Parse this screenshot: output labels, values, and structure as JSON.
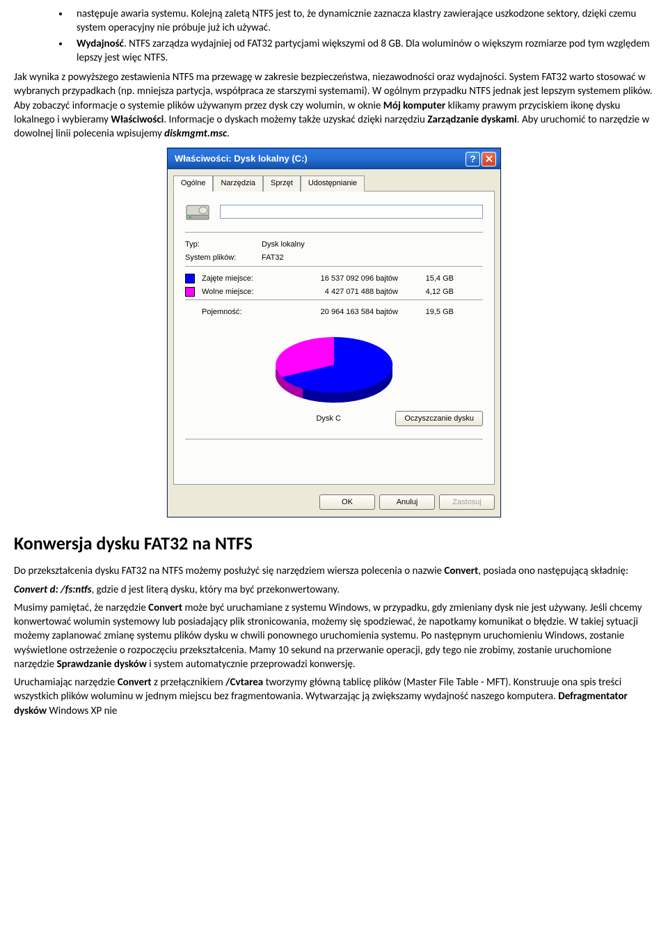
{
  "bullets": {
    "b1_pre": "następuje awaria systemu. Kolejną zaletą NTFS jest to, że dynamicznie zaznacza klastry zawierające uszkodzone sektory, dzięki czemu system operacyjny nie próbuje już ich używać.",
    "b2_head": "Wydajność",
    "b2_rest": ". NTFS zarządza wydajniej od FAT32 partycjami większymi od 8 GB. Dla woluminów o większym rozmiarze pod tym względem lepszy jest więc NTFS."
  },
  "para1": {
    "s1": "Jak wynika z powyższego zestawienia NTFS ma przewagę w zakresie bezpieczeństwa, niezawodności oraz wydajności. System FAT32 warto stosować w wybranych przypadkach (np. mniejsza partycja, współpraca ze starszymi systemami). W ogólnym przypadku NTFS jednak jest lepszym systemem plików. Aby zobaczyć informacje o systemie plików używanym przez dysk czy wolumin, w oknie ",
    "s1_b1": "Mój komputer",
    "s2": " klikamy prawym przyciskiem ikonę dysku lokalnego i wybieramy ",
    "s2_b1": "Właściwości",
    "s3": ". Informacje o dyskach możemy także uzyskać dzięki narzędziu ",
    "s3_b1": "Zarządzanie dyskami",
    "s4": ". Aby uruchomić to narzędzie w dowolnej linii polecenia wpisujemy ",
    "s4_bi": "diskmgmt.msc",
    "s5": "."
  },
  "dialog": {
    "title": "Właściwości: Dysk lokalny (C:)",
    "tabs": [
      "Ogólne",
      "Narzędzia",
      "Sprzęt",
      "Udostępnianie"
    ],
    "type_label": "Typ:",
    "type_value": "Dysk lokalny",
    "fs_label": "System plików:",
    "fs_value": "FAT32",
    "used_label": "Zajęte miejsce:",
    "used_bytes": "16 537 092 096 bajtów",
    "used_gb": "15,4 GB",
    "free_label": "Wolne miejsce:",
    "free_bytes": "4 427 071 488 bajtów",
    "free_gb": "4,12 GB",
    "cap_label": "Pojemność:",
    "cap_bytes": "20 964 163 584 bajtów",
    "cap_gb": "19,5 GB",
    "pie_label": "Dysk C",
    "cleanup": "Oczyszczanie dysku",
    "ok": "OK",
    "cancel": "Anuluj",
    "apply": "Zastosuj"
  },
  "heading2": "Konwersja dysku FAT32 na NTFS",
  "para2": {
    "s1": "Do przekształcenia dysku FAT32 na NTFS możemy posłużyć się narzędziem wiersza polecenia o nazwie ",
    "s1_b1": "Convert",
    "s2": ", posiada ono następującą składnię:"
  },
  "para3": {
    "bi": "Convert d: /fs:ntfs",
    "rest": ", gdzie d jest literą dysku, który ma być przekonwertowany."
  },
  "para4": {
    "s1": "Musimy pamiętać, że narzędzie ",
    "b1": "Convert",
    "s2": " może być uruchamiane z systemu Windows, w przypadku, gdy zmieniany dysk nie jest używany. Jeśli chcemy konwertować wolumin systemowy lub posiadający plik stronicowania, możemy się spodziewać, że napotkamy komunikat o błędzie. W takiej sytuacji możemy zaplanować zmianę systemu plików dysku w chwili ponownego uruchomienia systemu. Po następnym uruchomieniu Windows, zostanie wyświetlone ostrzeżenie o rozpoczęciu przekształcenia. Mamy 10 sekund na przerwanie operacji, gdy tego nie zrobimy, zostanie uruchomione narzędzie ",
    "b2": "Sprawdzanie dysków",
    "s3": " i system automatycznie przeprowadzi konwersję."
  },
  "para5": {
    "s1": "Uruchamiając narzędzie ",
    "b1": "Convert",
    "s2": " z przełącznikiem ",
    "b2": "/Cvtarea",
    "s3": " tworzymy główną tablicę plików (Master File Table - MFT). Konstruuje ona spis treści wszystkich plików woluminu w jednym miejscu bez fragmentowania. Wytwarzając ją zwiększamy wydajność naszego komputera. ",
    "b3": "Defragmentator dysków",
    "s4": " Windows XP nie"
  },
  "chart_data": {
    "type": "pie",
    "title": "Dysk C",
    "series": [
      {
        "name": "Zajęte miejsce",
        "value": 16537092096,
        "color": "#0000ff"
      },
      {
        "name": "Wolne miejsce",
        "value": 4427071488,
        "color": "#ff00ff"
      }
    ],
    "total": 20964163584
  }
}
